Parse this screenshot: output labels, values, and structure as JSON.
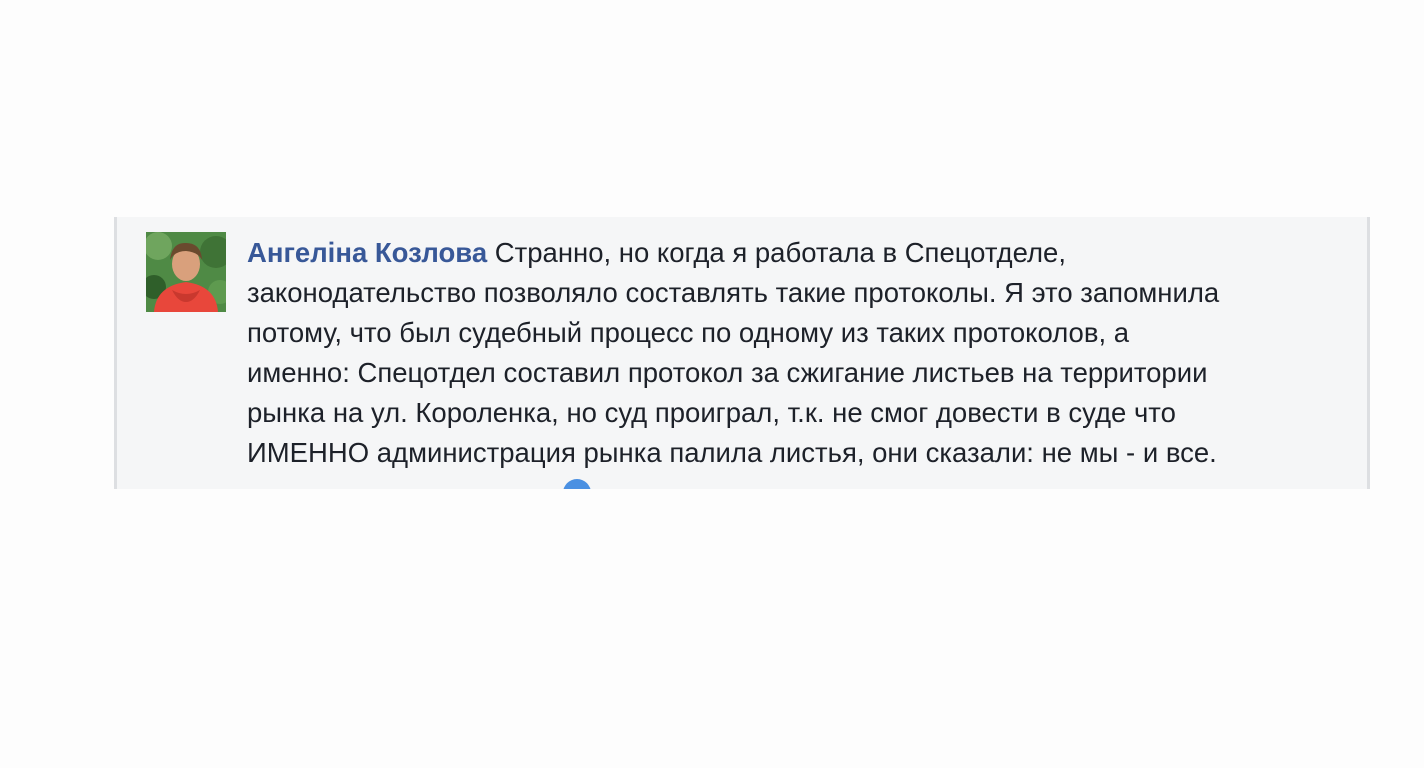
{
  "comment": {
    "author": "Ангеліна Козлова",
    "lines": [
      "Странно, но когда я работала в Спецотделе,",
      "законодательство позволяло составлять такие протоколы. Я это запомнила",
      "потому, что был судебный процесс по одному из таких протоколов, а",
      "именно: Спецотдел составил протокол за сжигание листьев на территории",
      "рынка на ул. Короленка, но суд проиграл, т.к. не смог довести в суде что",
      "ИМЕННО администрация рынка палила листья, они сказали: не мы - и все."
    ]
  },
  "colors": {
    "author": "#385898",
    "text": "#1d2129",
    "panel_bg": "#f5f6f7",
    "panel_border": "#dddfe2"
  }
}
